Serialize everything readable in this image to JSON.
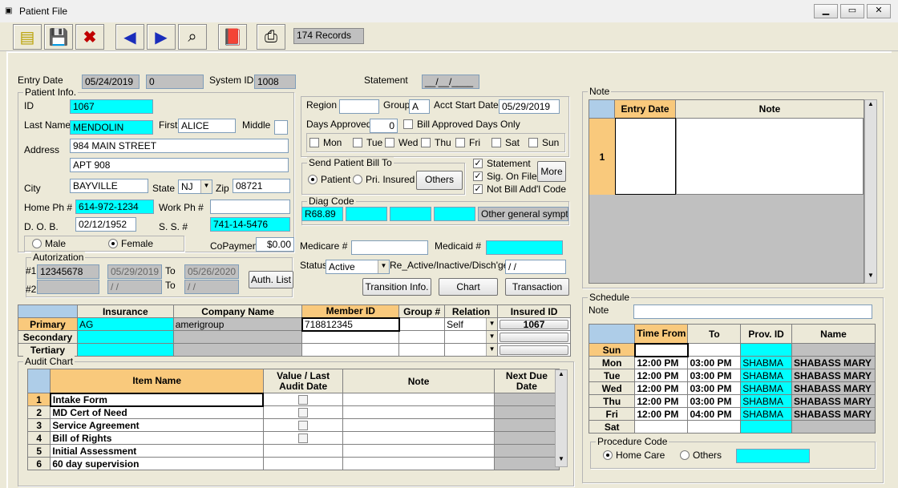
{
  "window": {
    "title": "Patient File",
    "records": "174 Records"
  },
  "entry": {
    "entry_date_label": "Entry Date",
    "entry_date": "05/24/2019",
    "entry_num": "0",
    "system_id_label": "System ID",
    "system_id": "1008",
    "statement_label": "Statement",
    "statement_val": "__/__/____"
  },
  "patient": {
    "group_title": "Patient Info.",
    "id_label": "ID",
    "id": "1067",
    "last_label": "Last Name",
    "last": "MENDOLIN",
    "first_label": "First",
    "first": "ALICE",
    "middle_label": "Middle",
    "address_label": "Address",
    "addr1": "984 MAIN STREET",
    "addr2": "APT 908",
    "city_label": "City",
    "city": "BAYVILLE",
    "state_label": "State",
    "state": "NJ",
    "zip_label": "Zip",
    "zip": "08721",
    "home_label": "Home Ph #",
    "home": "614-972-1234",
    "work_label": "Work Ph #",
    "dob_label": "D. O. B.",
    "dob": "02/12/1952",
    "ss_label": "S. S. #",
    "ss": "741-14-5476",
    "male": "Male",
    "female": "Female",
    "copay_label": "CoPayment",
    "copay": "$0.00"
  },
  "auth": {
    "title": "Autorization",
    "n1": "#1",
    "n2": "#2",
    "num1": "12345678",
    "from1": "05/29/2019",
    "to_label": "To",
    "to1": "05/26/2020",
    "from2": " / /",
    "to2": " / /",
    "button": "Auth. List"
  },
  "region": {
    "region_label": "Region",
    "group_label": "Group",
    "group": "A",
    "acct_label": "Acct Start Date",
    "acct": "05/29/2019",
    "days_label": "Days Approved",
    "days": "0",
    "bill_approved": "Bill Approved Days Only",
    "days_of_week": [
      "Mon",
      "Tue",
      "Wed",
      "Thu",
      "Fri",
      "Sat",
      "Sun"
    ]
  },
  "bill": {
    "title": "Send Patient Bill To",
    "patient": "Patient",
    "insured": "Pri. Insured",
    "others": "Others",
    "statement": "Statement",
    "sig": "Sig. On File",
    "notbill": "Not Bill Add'l Code",
    "more": "More"
  },
  "diag": {
    "title": "Diag Code",
    "code1": "R68.89",
    "desc": "Other general symptom"
  },
  "medicare": {
    "medicare_label": "Medicare #",
    "medicaid_label": "Medicaid #",
    "status_label": "Status",
    "status": "Active",
    "reactive_label": "Re_Active/Inactive/Disch'ged",
    "reactive": " / /",
    "transition": "Transition Info.",
    "chart": "Chart",
    "transaction": "Transaction"
  },
  "insurance": {
    "headers": [
      "Insurance",
      "Company Name",
      "Member ID",
      "Group #",
      "Relation",
      "Insured ID"
    ],
    "rows": [
      {
        "label": "Primary",
        "ins": "AG",
        "company": "amerigroup",
        "member": "718812345",
        "group": "",
        "relation": "Self",
        "insured": "1067"
      },
      {
        "label": "Secondary",
        "ins": "",
        "company": "",
        "member": "",
        "group": "",
        "relation": "",
        "insured": ""
      },
      {
        "label": "Tertiary",
        "ins": "",
        "company": "",
        "member": "",
        "group": "",
        "relation": "",
        "insured": ""
      }
    ]
  },
  "audit": {
    "title": "Audit Chart",
    "headers": [
      "Item Name",
      "Value / Last Audit Date",
      "Note",
      "Next Due Date"
    ],
    "rows": [
      {
        "n": "1",
        "item": "Intake Form"
      },
      {
        "n": "2",
        "item": "MD Cert of Need"
      },
      {
        "n": "3",
        "item": "Service Agreement"
      },
      {
        "n": "4",
        "item": "Bill of Rights"
      },
      {
        "n": "5",
        "item": "Initial Assessment"
      },
      {
        "n": "6",
        "item": "60 day supervision"
      }
    ]
  },
  "note": {
    "title": "Note",
    "headers": [
      "Entry Date",
      "Note"
    ],
    "row1": "1"
  },
  "schedule": {
    "title": "Schedule",
    "note_label": "Note",
    "headers": [
      "Time From",
      "To",
      "Prov. ID",
      "Name"
    ],
    "rows": [
      {
        "day": "Sun",
        "from": "",
        "to": "",
        "prov": "",
        "name": ""
      },
      {
        "day": "Mon",
        "from": "12:00 PM",
        "to": "03:00 PM",
        "prov": "SHABMA",
        "name": "SHABASS MARY"
      },
      {
        "day": "Tue",
        "from": "12:00 PM",
        "to": "03:00 PM",
        "prov": "SHABMA",
        "name": "SHABASS MARY"
      },
      {
        "day": "Wed",
        "from": "12:00 PM",
        "to": "03:00 PM",
        "prov": "SHABMA",
        "name": "SHABASS MARY"
      },
      {
        "day": "Thu",
        "from": "12:00 PM",
        "to": "03:00 PM",
        "prov": "SHABMA",
        "name": "SHABASS MARY"
      },
      {
        "day": "Fri",
        "from": "12:00 PM",
        "to": "04:00 PM",
        "prov": "SHABMA",
        "name": "SHABASS MARY"
      },
      {
        "day": "Sat",
        "from": "",
        "to": "",
        "prov": "",
        "name": ""
      }
    ]
  },
  "procedure": {
    "title": "Procedure Code",
    "home": "Home Care",
    "others": "Others"
  }
}
